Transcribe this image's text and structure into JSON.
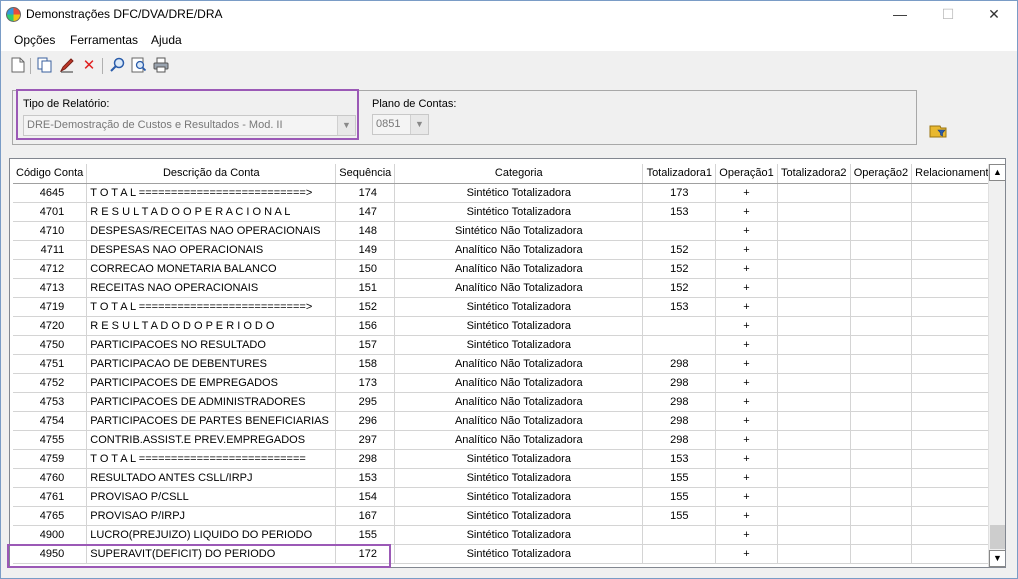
{
  "window": {
    "title": "Demonstrações DFC/DVA/DRE/DRA",
    "minimize": "—",
    "maximize": "☐",
    "close": "✕"
  },
  "menu": {
    "items": [
      {
        "label": "Opções"
      },
      {
        "label": "Ferramentas"
      },
      {
        "label": "Ajuda"
      }
    ]
  },
  "toolbar": {
    "icons": [
      "new-document-icon",
      "copy-icon",
      "edit-icon",
      "delete-icon",
      "search-icon",
      "zoom-search-icon",
      "print-icon"
    ]
  },
  "form": {
    "tipo_label": "Tipo de Relatório:",
    "tipo_value": "DRE-Demostração de Custos e Resultados - Mod. II",
    "plano_label": "Plano de Contas:",
    "plano_value": "0851"
  },
  "colors": {
    "highlight": "#9b59b6"
  },
  "table": {
    "columns": [
      "Código Conta",
      "Descrição da Conta",
      "Sequência",
      "Categoria",
      "Totalizadora1",
      "Operação1",
      "Totalizadora2",
      "Operação2",
      "Relacionamento"
    ],
    "rows": [
      [
        "4645",
        "T O T A L ==========================>",
        "174",
        "Sintético Totalizadora",
        "173",
        "+",
        "",
        "",
        ""
      ],
      [
        "4701",
        "R E S U L T A D O    O P E R A C I O N A L",
        "147",
        "Sintético Totalizadora",
        "153",
        "+",
        "",
        "",
        ""
      ],
      [
        "4710",
        "DESPESAS/RECEITAS NAO OPERACIONAIS",
        "148",
        "Sintético Não Totalizadora",
        "",
        "+",
        "",
        "",
        ""
      ],
      [
        "4711",
        "DESPESAS NAO OPERACIONAIS",
        "149",
        "Analítico Não Totalizadora",
        "152",
        "+",
        "",
        "",
        ""
      ],
      [
        "4712",
        "CORRECAO MONETARIA BALANCO",
        "150",
        "Analítico Não Totalizadora",
        "152",
        "+",
        "",
        "",
        ""
      ],
      [
        "4713",
        "RECEITAS NAO OPERACIONAIS",
        "151",
        "Analítico Não Totalizadora",
        "152",
        "+",
        "",
        "",
        ""
      ],
      [
        "4719",
        "T O T A L ==========================>",
        "152",
        "Sintético Totalizadora",
        "153",
        "+",
        "",
        "",
        ""
      ],
      [
        "4720",
        "R E S U L T A D O  D O  P E R I O D O",
        "156",
        "Sintético Totalizadora",
        "",
        "+",
        "",
        "",
        ""
      ],
      [
        "4750",
        "PARTICIPACOES NO RESULTADO",
        "157",
        "Sintético Totalizadora",
        "",
        "+",
        "",
        "",
        ""
      ],
      [
        "4751",
        "PARTICIPACAO DE DEBENTURES",
        "158",
        "Analítico Não Totalizadora",
        "298",
        "+",
        "",
        "",
        ""
      ],
      [
        "4752",
        "PARTICIPACOES DE EMPREGADOS",
        "173",
        "Analítico Não Totalizadora",
        "298",
        "+",
        "",
        "",
        ""
      ],
      [
        "4753",
        "PARTICIPACOES DE ADMINISTRADORES",
        "295",
        "Analítico Não Totalizadora",
        "298",
        "+",
        "",
        "",
        ""
      ],
      [
        "4754",
        "PARTICIPACOES DE PARTES BENEFICIARIAS",
        "296",
        "Analítico Não Totalizadora",
        "298",
        "+",
        "",
        "",
        ""
      ],
      [
        "4755",
        "CONTRIB.ASSIST.E PREV.EMPREGADOS",
        "297",
        "Analítico Não Totalizadora",
        "298",
        "+",
        "",
        "",
        ""
      ],
      [
        "4759",
        "T O T A L ==========================",
        "298",
        "Sintético Totalizadora",
        "153",
        "+",
        "",
        "",
        ""
      ],
      [
        "4760",
        "RESULTADO ANTES CSLL/IRPJ",
        "153",
        "Sintético Totalizadora",
        "155",
        "+",
        "",
        "",
        ""
      ],
      [
        "4761",
        "PROVISAO P/CSLL",
        "154",
        "Sintético Totalizadora",
        "155",
        "+",
        "",
        "",
        ""
      ],
      [
        "4765",
        "PROVISAO P/IRPJ",
        "167",
        "Sintético Totalizadora",
        "155",
        "+",
        "",
        "",
        ""
      ],
      [
        "4900",
        "LUCRO(PREJUIZO) LIQUIDO DO PERIODO",
        "155",
        "Sintético Totalizadora",
        "",
        "+",
        "",
        "",
        ""
      ],
      [
        "4950",
        "SUPERAVIT(DEFICIT) DO PERIODO",
        "172",
        "Sintético Totalizadora",
        "",
        "+",
        "",
        "",
        ""
      ]
    ]
  }
}
